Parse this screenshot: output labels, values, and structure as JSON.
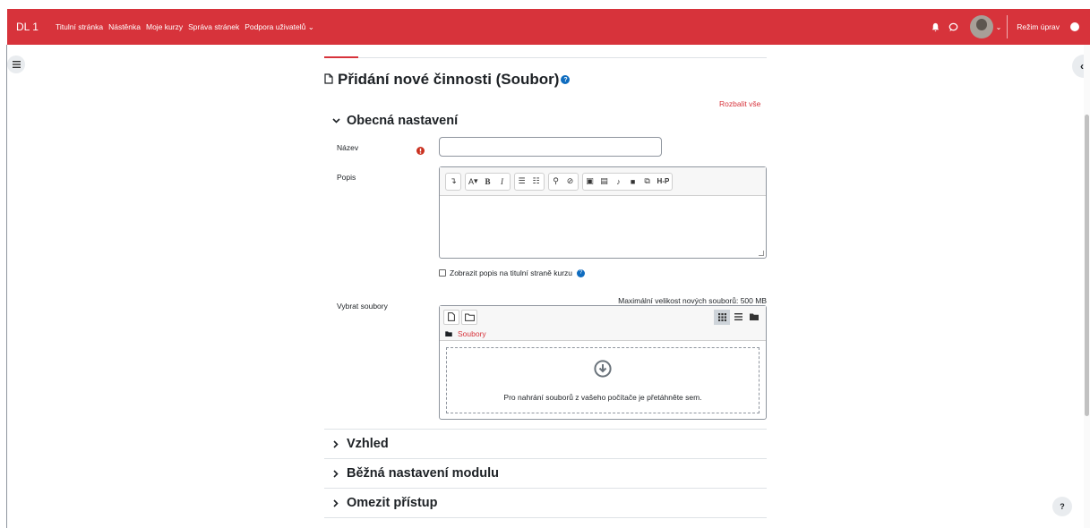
{
  "navbar": {
    "brand": "DL 1",
    "links": [
      "Titulní stránka",
      "Nástěnka",
      "Moje kurzy",
      "Správa stránek",
      "Podpora uživatelů"
    ],
    "edit_mode_label": "Režim úprav",
    "color": "#d7333b"
  },
  "page": {
    "title": "Přidání nové činnosti (Soubor)",
    "expand_all": "Rozbalit vše"
  },
  "sections": {
    "general": "Obecná nastavení",
    "appearance": "Vzhled",
    "common": "Běžná nastavení modulu",
    "restrict": "Omezit přístup"
  },
  "form": {
    "name_label": "Název",
    "name_value": "",
    "description_label": "Popis",
    "show_description": "Zobrazit popis na titulní straně kurzu",
    "show_description_checked": false,
    "select_files_label": "Vybrat soubory",
    "max_size": "Maximální velikost nových souborů: 500 MB",
    "folder_label": "Soubory",
    "drop_text": "Pro nahrání souborů z vašeho počítače je přetáhněte sem."
  },
  "editor_toolbar": {
    "font_size": "A",
    "bold": "B",
    "italic": "I",
    "h5p": "H-P"
  },
  "help_button": "?"
}
